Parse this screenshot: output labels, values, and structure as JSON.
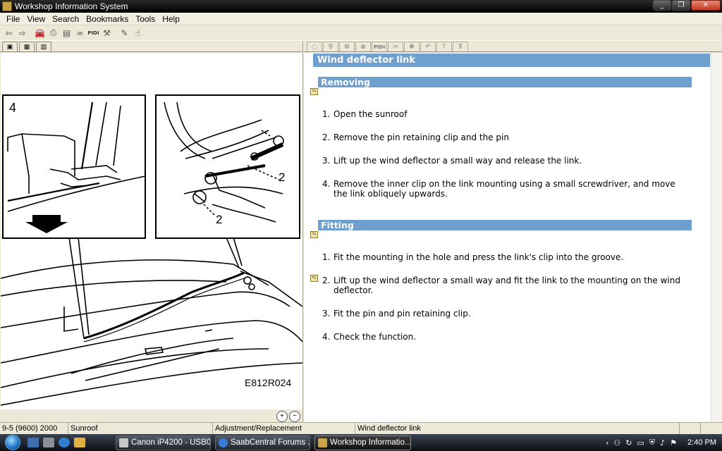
{
  "window": {
    "title": "Workshop Information System"
  },
  "menu": [
    "File",
    "View",
    "Search",
    "Bookmarks",
    "Tools",
    "Help"
  ],
  "toolbar": {
    "buttons": [
      {
        "name": "back-arrow-icon",
        "glyph": "⇦"
      },
      {
        "name": "forward-arrow-icon",
        "glyph": "⇨"
      },
      {
        "name": "car-icon",
        "glyph": "🚘"
      },
      {
        "name": "print-icon",
        "glyph": "⎙"
      },
      {
        "name": "notes-icon",
        "glyph": "▤"
      },
      {
        "name": "binoculars-icon",
        "glyph": "∞"
      },
      {
        "name": "pi-icon",
        "glyph": "PI"
      },
      {
        "name": "wrench-icon",
        "glyph": "⚒"
      },
      {
        "name": "pencil-icon",
        "glyph": "✎"
      },
      {
        "name": "hand-icon",
        "glyph": "☝"
      }
    ],
    "pi_label": "PIDI"
  },
  "left_tabs": [
    "▣",
    "▦",
    "▧"
  ],
  "illustration": {
    "label_left": "4",
    "label_callout": "2",
    "code": "E812R024"
  },
  "right_tabs": [
    "◌",
    "⚲",
    "⚙",
    "⊗",
    "PIDI",
    "✂",
    "✥",
    "↶",
    "⊤",
    "⊼"
  ],
  "doc": {
    "title": "Wind deflector link",
    "sections": [
      {
        "heading": "Removing",
        "steps": [
          "Open the sunroof",
          "Remove the pin retaining clip and the pin",
          "Lift up the wind deflector a small way and release the link.",
          "Remove the inner clip on the link mounting using a small screwdriver, and move the link obliquely upwards."
        ]
      },
      {
        "heading": "Fitting",
        "steps": [
          "Fit the mounting in the hole and press the link's clip into the groove.",
          "Lift up the wind deflector a small way and fit the link to the mounting on the wind deflector.",
          "Fit the pin and pin retaining clip.",
          "Check the function."
        ]
      }
    ]
  },
  "statusbar": [
    "9-5 (9600) 2000",
    "Sunroof",
    "Adjustment/Replacement",
    "Wind deflector link"
  ],
  "taskbar": {
    "tasks": [
      {
        "label": "Canon iP4200 - USB0...",
        "icon_color": "#c8c8c8"
      },
      {
        "label": "SaabCentral Forums ...",
        "icon_color": "#3a7bd5"
      },
      {
        "label": "Workshop Informatio...",
        "icon_color": "#c9a24a"
      }
    ],
    "clock": "2:40 PM"
  },
  "zoom": {
    "in": "+",
    "out": "−"
  }
}
